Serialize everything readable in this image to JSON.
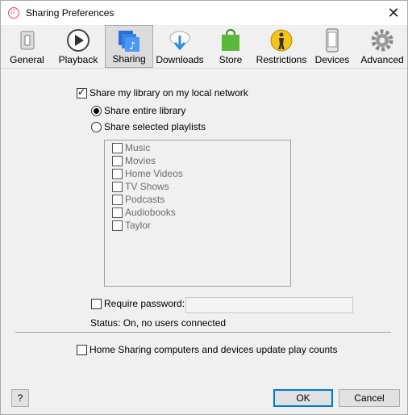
{
  "window": {
    "title": "Sharing Preferences",
    "close_glyph": "✕"
  },
  "toolbar": {
    "tabs": [
      {
        "label": "General",
        "icon": "general-switch-icon"
      },
      {
        "label": "Playback",
        "icon": "play-icon"
      },
      {
        "label": "Sharing",
        "icon": "sharing-music-icon",
        "active": true
      },
      {
        "label": "Downloads",
        "icon": "download-cloud-icon"
      },
      {
        "label": "Store",
        "icon": "store-bag-icon"
      },
      {
        "label": "Restrictions",
        "icon": "restrictions-icon"
      },
      {
        "label": "Devices",
        "icon": "device-phone-icon"
      },
      {
        "label": "Advanced",
        "icon": "gear-icon"
      }
    ]
  },
  "sharing": {
    "share_library": {
      "label": "Share my library on my local network",
      "checked": true
    },
    "share_entire": {
      "label": "Share entire library",
      "checked": true
    },
    "share_selected": {
      "label": "Share selected playlists",
      "checked": false
    },
    "playlists": [
      "Music",
      "Movies",
      "Home Videos",
      "TV Shows",
      "Podcasts",
      "Audiobooks",
      "Taylor"
    ],
    "require_password": {
      "label": "Require password:",
      "checked": false,
      "value": ""
    },
    "status": "Status: On, no users connected",
    "update_play_counts": {
      "label": "Home Sharing computers and devices update play counts",
      "checked": false
    }
  },
  "footer": {
    "help": "?",
    "ok": "OK",
    "cancel": "Cancel"
  },
  "colors": {
    "accent": "#0078d7",
    "store_green": "#5cb83a",
    "restrictions_yellow": "#f5c518",
    "downloads_blue": "#2e8fe0"
  }
}
